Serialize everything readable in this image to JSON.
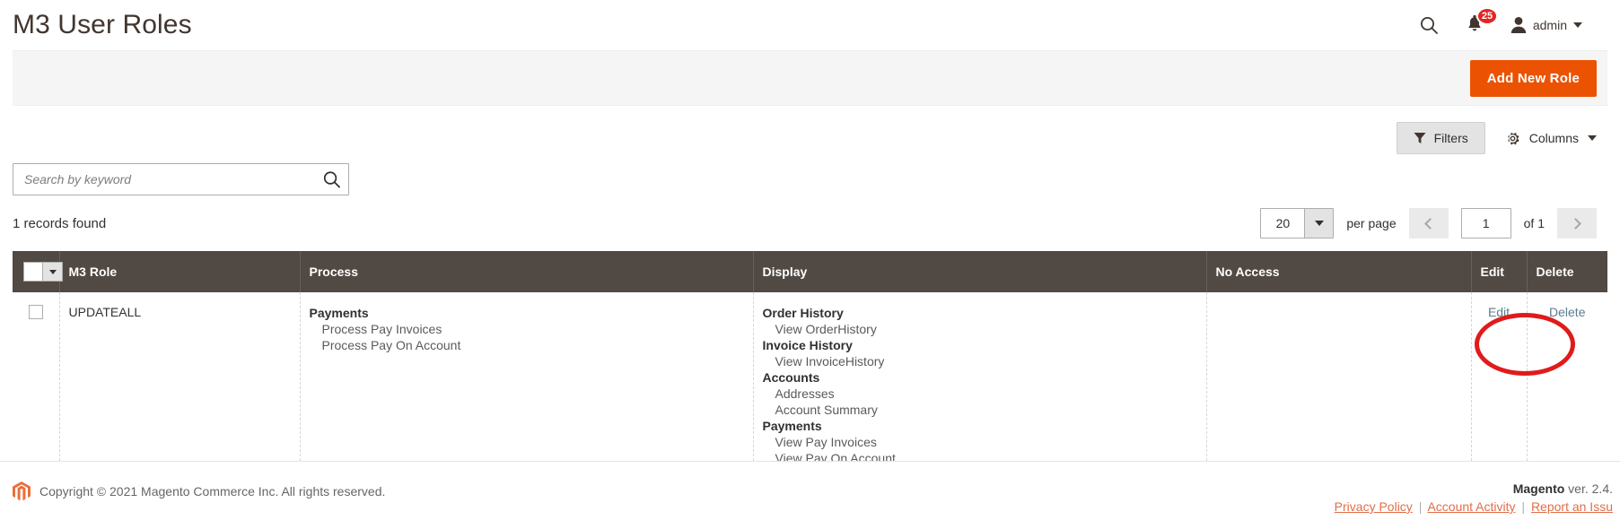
{
  "header": {
    "title": "M3 User Roles",
    "search_icon": "search-icon",
    "notifications_icon": "bell-icon",
    "notifications_count": "25",
    "user_icon": "user-avatar-icon",
    "user_name": "admin"
  },
  "action_bar": {
    "add_new_role_label": "Add New Role"
  },
  "grid_controls": {
    "filters_label": "Filters",
    "filters_icon": "funnel-icon",
    "columns_label": "Columns",
    "columns_icon": "gear-icon"
  },
  "search": {
    "placeholder": "Search by keyword",
    "value": "",
    "submit_icon": "search-icon"
  },
  "summary": {
    "records_found": "1 records found"
  },
  "pager": {
    "per_page_value": "20",
    "per_page_label": "per page",
    "previous_icon": "chevron-left-icon",
    "next_icon": "chevron-right-icon",
    "current_page": "1",
    "total_pages_label": "of 1"
  },
  "table": {
    "columns": [
      {
        "key": "select",
        "label": ""
      },
      {
        "key": "role",
        "label": "M3 Role"
      },
      {
        "key": "process",
        "label": "Process"
      },
      {
        "key": "display",
        "label": "Display"
      },
      {
        "key": "no_access",
        "label": "No Access"
      },
      {
        "key": "edit",
        "label": "Edit"
      },
      {
        "key": "delete",
        "label": "Delete"
      }
    ],
    "rows": [
      {
        "role": "UPDATEALL",
        "process": [
          {
            "group": "Payments",
            "items": [
              "Process Pay Invoices",
              "Process Pay On Account"
            ]
          }
        ],
        "display": [
          {
            "group": "Order History",
            "items": [
              "View OrderHistory"
            ]
          },
          {
            "group": "Invoice History",
            "items": [
              "View InvoiceHistory"
            ]
          },
          {
            "group": "Accounts",
            "items": [
              "Addresses",
              "Account Summary"
            ]
          },
          {
            "group": "Payments",
            "items": [
              "View Pay Invoices",
              "View Pay On Account"
            ]
          }
        ],
        "no_access": "",
        "edit_label": "Edit",
        "delete_label": "Delete"
      }
    ]
  },
  "annotation": {
    "shape": "red-ellipse-highlight",
    "target": "edit-link",
    "color": "#e01b1b"
  },
  "footer": {
    "logo_icon": "magento-logo-icon",
    "copyright": "Copyright © 2021 Magento Commerce Inc. All rights reserved.",
    "version_brand": "Magento",
    "version_text": " ver. 2.4.",
    "links": [
      {
        "label": "Privacy Policy"
      },
      {
        "label": "Account Activity"
      },
      {
        "label": "Report an Issu"
      }
    ],
    "separator": "|"
  },
  "colors": {
    "accent_orange": "#eb5202",
    "table_header": "#514943",
    "badge_red": "#e22626",
    "link_blue": "#5b7c90",
    "footer_link": "#e06e4a"
  }
}
